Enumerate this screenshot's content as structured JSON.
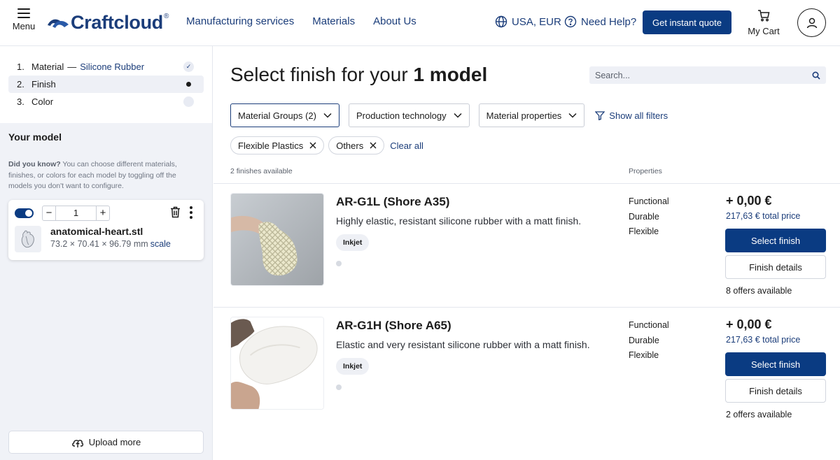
{
  "header": {
    "menu_label": "Menu",
    "logo_text": "Craftcloud",
    "logo_reg": "®",
    "nav": [
      "Manufacturing services",
      "Materials",
      "About Us"
    ],
    "region": "USA, EUR",
    "help": "Need Help?",
    "quote_button": "Get instant quote",
    "cart_label": "My Cart"
  },
  "sidebar": {
    "steps": [
      {
        "num": "1.",
        "label": "Material",
        "sep": "—",
        "value": "Silicone Rubber",
        "state": "done"
      },
      {
        "num": "2.",
        "label": "Finish",
        "state": "current"
      },
      {
        "num": "3.",
        "label": "Color",
        "state": "pending"
      }
    ],
    "your_model_heading": "Your model",
    "did_you_know_bold": "Did you know?",
    "did_you_know_text": " You can choose different materials, finishes, or colors for each model by toggling off the models you don't want to configure.",
    "model": {
      "quantity": "1",
      "minus": "−",
      "plus": "+",
      "filename": "anatomical-heart.stl",
      "dimensions": "73.2 × 70.41 × 96.79 mm",
      "scale_link": "scale"
    },
    "upload_more": "Upload more"
  },
  "main": {
    "title_prefix": "Select finish for your ",
    "title_bold": "1 model",
    "search_placeholder": "Search...",
    "filters": [
      "Material Groups (2)",
      "Production technology",
      "Material properties"
    ],
    "show_all_filters": "Show all filters",
    "chips": [
      "Flexible Plastics",
      "Others"
    ],
    "clear_all": "Clear all",
    "count_label": "2 finishes available",
    "properties_label": "Properties",
    "finishes": [
      {
        "name": "AR-G1L (Shore A35)",
        "description": "Highly elastic, resistant silicone rubber with a matt finish.",
        "technology": "Inkjet",
        "properties": [
          "Functional",
          "Durable",
          "Flexible"
        ],
        "price": "+ 0,00 €",
        "total": "217,63 € total price",
        "select_label": "Select finish",
        "details_label": "Finish details",
        "offers": "8 offers available"
      },
      {
        "name": "AR-G1H (Shore A65)",
        "description": "Elastic and very resistant silicone rubber with a matt finish.",
        "technology": "Inkjet",
        "properties": [
          "Functional",
          "Durable",
          "Flexible"
        ],
        "price": "+ 0,00 €",
        "total": "217,63 € total price",
        "select_label": "Select finish",
        "details_label": "Finish details",
        "offers": "2 offers available"
      }
    ]
  },
  "colors": {
    "brand": "#0a3b82",
    "link": "#1b3d7a",
    "sidebar_bg": "#f0f2f7"
  },
  "icons": [
    "menu-icon",
    "globe-icon",
    "help-icon",
    "cart-icon",
    "user-icon",
    "check-icon",
    "trash-icon",
    "kebab-icon",
    "upload-icon",
    "search-icon",
    "chevron-down-icon",
    "filter-icon",
    "close-icon"
  ]
}
